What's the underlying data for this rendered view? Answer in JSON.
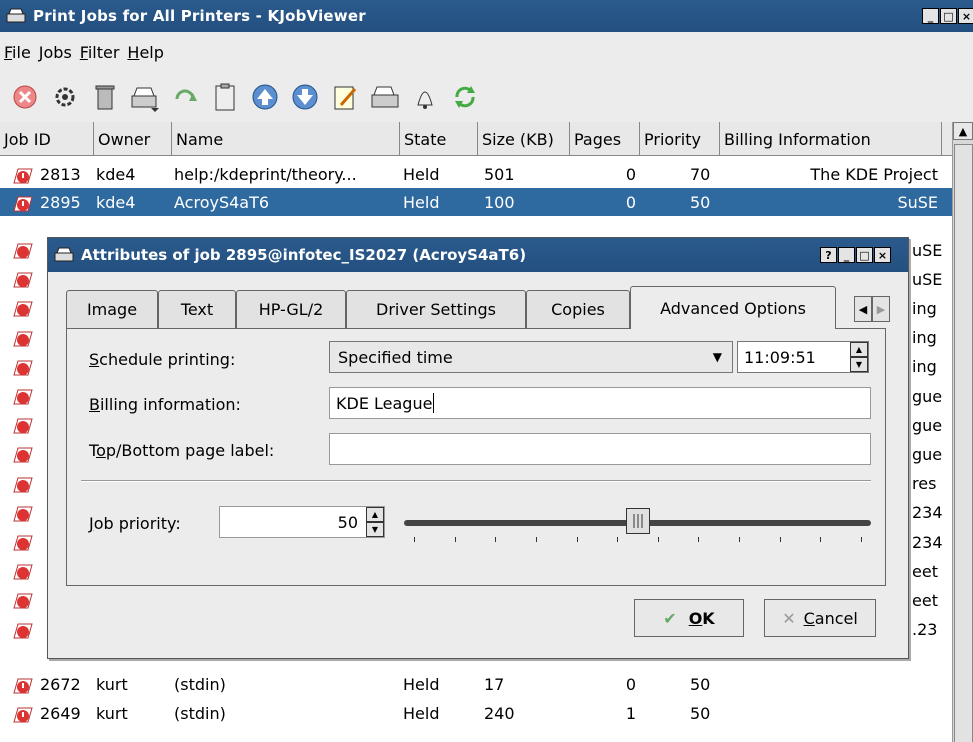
{
  "window": {
    "title": "Print Jobs for All Printers - KJobViewer",
    "controls": [
      "_",
      "□",
      "×"
    ]
  },
  "menu": [
    "File",
    "Jobs",
    "Filter",
    "Help"
  ],
  "toolbar_icons": [
    "stop-icon",
    "settings-icon",
    "trash-icon",
    "printer-move-icon",
    "restart-icon",
    "clipboard-icon",
    "move-up-icon",
    "move-down-icon",
    "edit-icon",
    "printer-icon",
    "bell-icon",
    "refresh-icon"
  ],
  "table": {
    "columns": [
      "Job ID",
      "Owner",
      "Name",
      "State",
      "Size (KB)",
      "Pages",
      "Priority",
      "Billing Information"
    ],
    "rows": [
      {
        "id": "2813",
        "owner": "kde4",
        "name": "help:/kdeprint/theory...",
        "state": "Held",
        "size": "501",
        "pages": "0",
        "priority": "70",
        "billing": "The KDE Project",
        "selected": false
      },
      {
        "id": "2895",
        "owner": "kde4",
        "name": "AcroyS4aT6",
        "state": "Held",
        "size": "100",
        "pages": "0",
        "priority": "50",
        "billing": "SuSE",
        "selected": true
      },
      {
        "id": "2672",
        "owner": "kurt",
        "name": "(stdin)",
        "state": "Held",
        "size": "17",
        "pages": "0",
        "priority": "50",
        "billing": "",
        "selected": false
      },
      {
        "id": "2649",
        "owner": "kurt",
        "name": "(stdin)",
        "state": "Held",
        "size": "240",
        "pages": "1",
        "priority": "50",
        "billing": "",
        "selected": false
      }
    ],
    "billing_fragments": [
      "uSE",
      "uSE",
      "ing",
      "ing",
      "ing",
      "gue",
      "gue",
      "gue",
      "res",
      "234",
      "234",
      "eet",
      "eet",
      ".23"
    ]
  },
  "dialog": {
    "title": "Attributes of job 2895@infotec_IS2027 (AcroyS4aT6)",
    "controls": [
      "?",
      "_",
      "□",
      "×"
    ],
    "tabs": [
      "Image",
      "Text",
      "HP-GL/2",
      "Driver Settings",
      "Copies",
      "Advanced Options"
    ],
    "active_tab": "Advanced Options",
    "schedule": {
      "label_u": "S",
      "label_rest": "chedule printing:",
      "value": "Specified time",
      "time": "11:09:51"
    },
    "billing": {
      "label_u": "B",
      "label_rest": "illing information:",
      "value": "KDE League"
    },
    "pagelabel": {
      "label_pre": "T",
      "label_u": "o",
      "label_rest": "p/Bottom page label:",
      "value": ""
    },
    "priority": {
      "label_u": "J",
      "label_rest": "ob priority:",
      "value": "50",
      "slider_fraction": 0.5
    },
    "ok": {
      "u": "O",
      "rest": "K"
    },
    "cancel": {
      "u": "C",
      "rest": "ancel"
    }
  }
}
